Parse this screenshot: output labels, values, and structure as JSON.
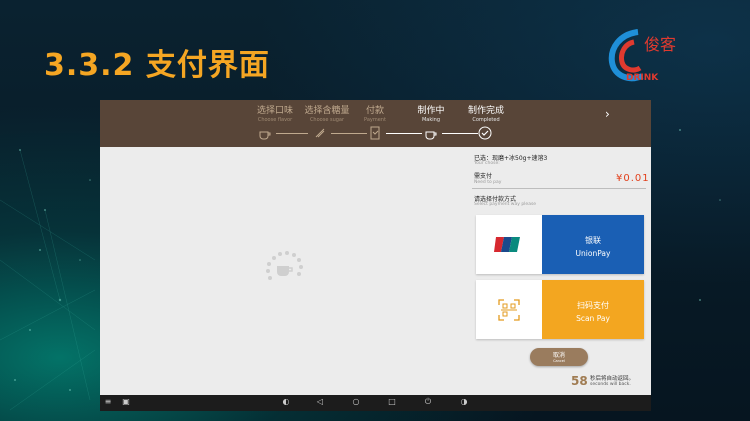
{
  "slide": {
    "title": "3.3.2 支付界面",
    "logo_text": "俊客",
    "logo_sub": "DRINK"
  },
  "steps": [
    {
      "cn": "选择口味",
      "en": "Choose flavor",
      "icon": "coffee-cup-icon"
    },
    {
      "cn": "选择含糖量",
      "en": "Choose sugar",
      "icon": "sugar-icon"
    },
    {
      "cn": "付款",
      "en": "Payment",
      "icon": "payment-icon"
    },
    {
      "cn": "制作中",
      "en": "Making",
      "icon": "coffee-cup-icon"
    },
    {
      "cn": "制作完成",
      "en": "Completed",
      "icon": "check-icon"
    }
  ],
  "order": {
    "selected_label": "已选：现磨+冰50g+速溶3",
    "selected_sub": "Your chose:",
    "need_label": "需支付",
    "need_sub": "Need to pay",
    "amount": "¥0.01"
  },
  "payment": {
    "choose_label": "请选择付款方式",
    "choose_sub": "Select payment way please",
    "methods": [
      {
        "cn": "银联",
        "en": "UnionPay",
        "color": "#1a5fb4"
      },
      {
        "cn": "扫码支付",
        "en": "Scan Pay",
        "color": "#f3a620"
      }
    ]
  },
  "cancel": {
    "cn": "取消",
    "en": "Cancel"
  },
  "countdown": {
    "seconds": "58",
    "cn": "秒后将自动返回。",
    "en": "seconds will back."
  },
  "colors": {
    "topbar": "#584538",
    "accent": "#f5a623",
    "amount": "#e2401c"
  }
}
